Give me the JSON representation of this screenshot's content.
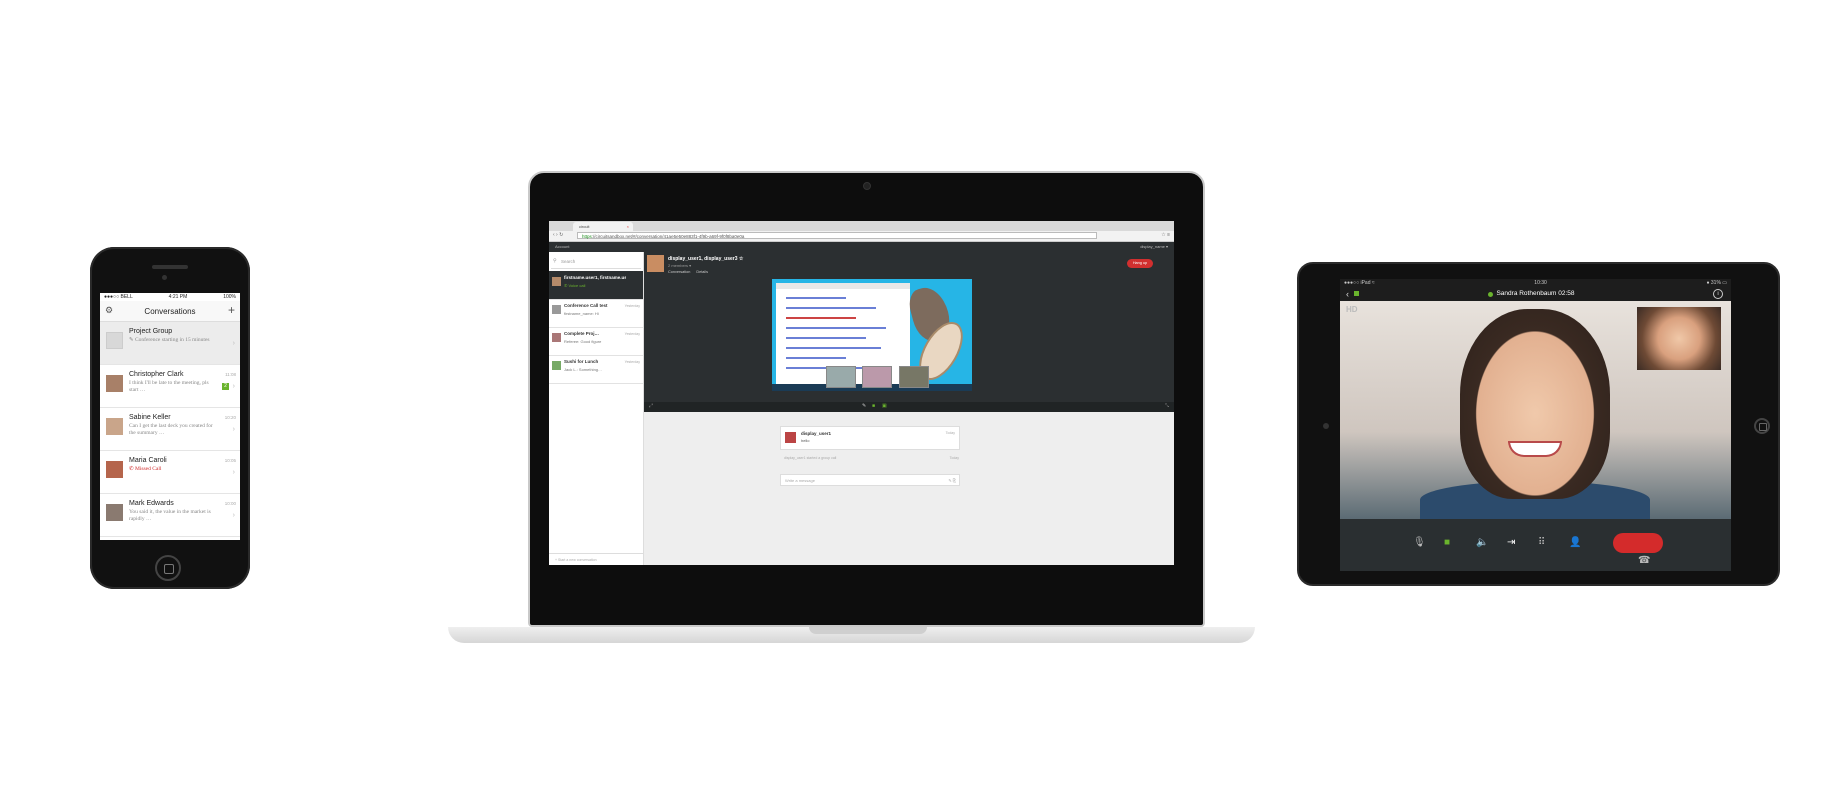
{
  "phone": {
    "status": {
      "carrier": "●●●○○ BELL",
      "time": "4:21 PM",
      "battery": "100%"
    },
    "title": "Conversations",
    "conversations": [
      {
        "name": "Project Group",
        "preview": "Conference starting in 15 minutes",
        "time": ""
      },
      {
        "name": "Christopher Clark",
        "preview": "I think I'll be late to the meeting, pls start …",
        "time": "11:08",
        "badge": "2"
      },
      {
        "name": "Sabine Keller",
        "preview": "Can I get the last deck you created for the summary …",
        "time": "10:20"
      },
      {
        "name": "Maria Caroli",
        "preview": "Missed Call",
        "time": "10:05"
      },
      {
        "name": "Mark Edwards",
        "preview": "You said it, the value in the market is rapidly …",
        "time": "10:00"
      }
    ]
  },
  "laptop": {
    "tab_label": "circuit",
    "url_https": "https",
    "url_rest": "://circuitsandbox.net/#/conversation/41ae5e50e883f1-4f9b-a69f-9f0f8ba0e0a",
    "app_bar_left": "Account",
    "app_bar_user": "display_name ▾",
    "search_placeholder": "Search",
    "conversations": [
      {
        "name": "firstname.user1, firstname.user4",
        "sub": "Voice call",
        "time": ""
      },
      {
        "name": "Conference Call test",
        "sub": "firstname_name: Hi",
        "time": "Yesterday"
      },
      {
        "name": "Complete Proj…",
        "sub": "Referee: Good figure",
        "time": "Yesterday"
      },
      {
        "name": "Sushi for Lunch",
        "sub": "Jack L.: Something…",
        "time": "Yesterday"
      }
    ],
    "sidebar_footer": "+  Start a new conversation",
    "header_name": "display_user1, display_user3  ☆",
    "header_sub": "2 members ▾",
    "header_tabs": [
      "Conversation",
      "Details"
    ],
    "hangup_label": "Hang up",
    "message": {
      "author": "display_user1",
      "text": "hello",
      "time": "Today"
    },
    "system_line": "display_user1 started a group call",
    "system_time": "Today",
    "compose_placeholder": "Write a message"
  },
  "tablet": {
    "status": {
      "left": "●●●○○ iPad  ≈",
      "time": "10:30",
      "right": "● 31% ▭"
    },
    "caller": "Sandra Rothenbaum  02:58",
    "hd_label": "HD",
    "end_icon": "end-call-icon"
  },
  "colors": {
    "accent_green": "#6ab42d",
    "hangup_red": "#d12f2f",
    "app_dark": "#2b2f31"
  }
}
